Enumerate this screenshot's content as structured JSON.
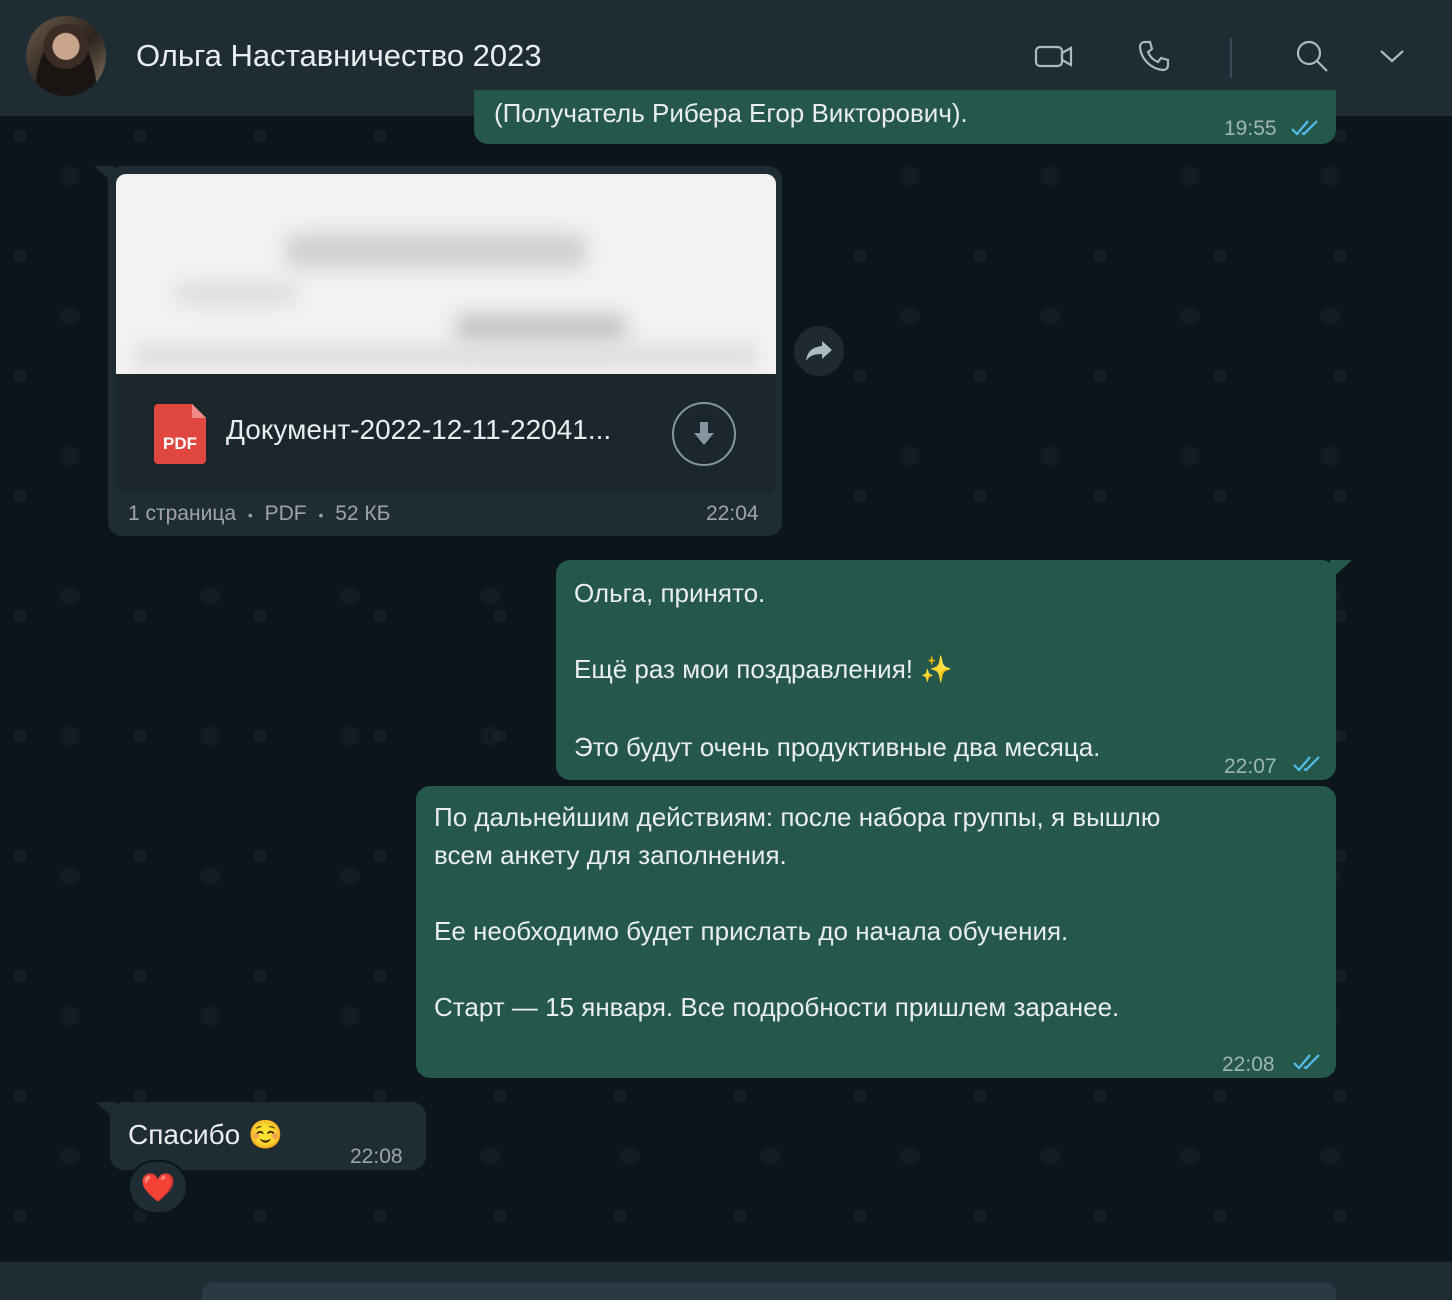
{
  "header": {
    "title": "Ольга Наставничество 2023"
  },
  "messages": {
    "prev_out": {
      "text": "(Получатель Рибера Егор Викторович).",
      "time": "19:55"
    },
    "doc": {
      "name": "Документ-2022-12-11-22041...",
      "icon_label": "PDF",
      "pages": "1 страница",
      "type": "PDF",
      "size": "52 КБ",
      "separator": "•",
      "time": "22:04"
    },
    "msg1": {
      "line1": "Ольга, принято.",
      "line2": "Ещё раз мои поздравления! ✨",
      "line3": "Это будут очень продуктивные два месяца.",
      "time": "22:07"
    },
    "msg2": {
      "line1": "По дальнейшим действиям: после набора группы, я вышлю",
      "line2": "всем анкету для заполнения.",
      "line3": "Ее необходимо будет прислать до начала обучения.",
      "line4": "Старт — 15 января. Все подробности пришлем заранее.",
      "time": "22:08"
    },
    "msg3": {
      "text": "Спасибо ☺️",
      "time": "22:08",
      "reaction": "❤️"
    }
  },
  "colors": {
    "outgoing": "#25584a",
    "incoming": "#202c33",
    "header": "#202c33",
    "read_ticks": "#53bdeb",
    "pdf": "#e0473f"
  }
}
